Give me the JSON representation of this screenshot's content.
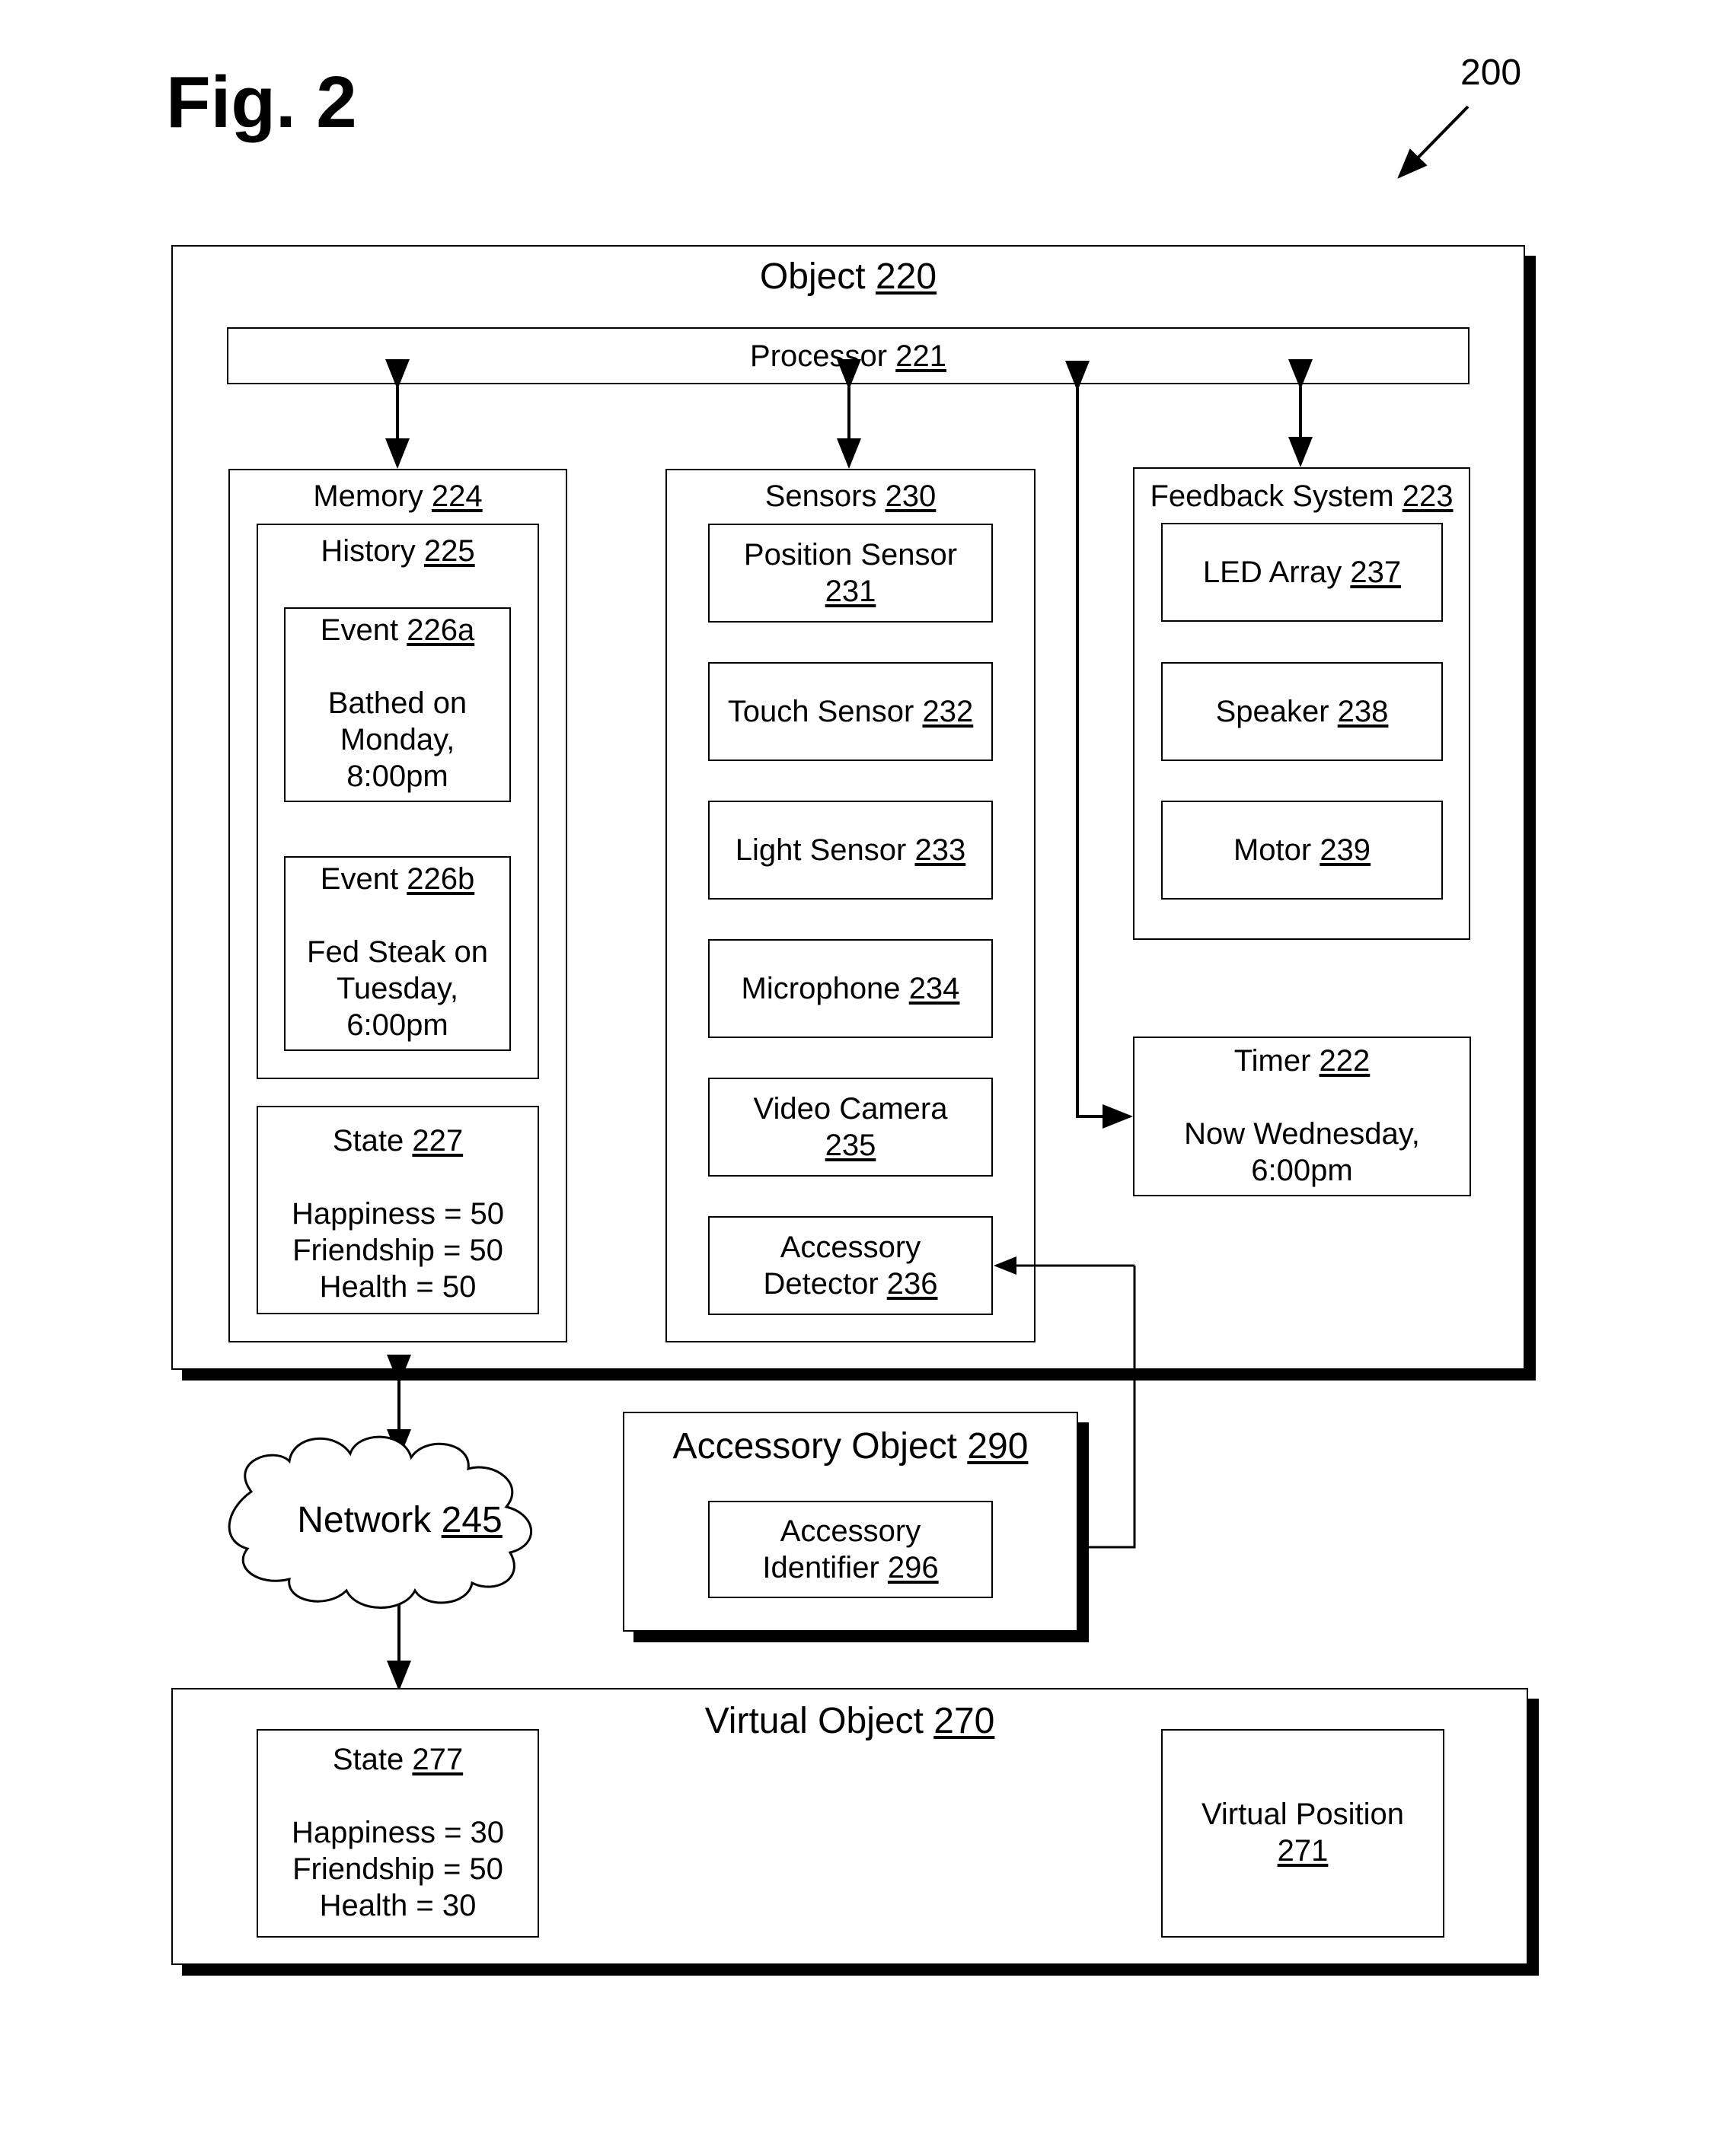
{
  "figure": {
    "title": "Fig. 2",
    "reference": "200"
  },
  "object": {
    "name": "Object",
    "num": "220",
    "processor": {
      "name": "Processor",
      "num": "221"
    },
    "memory": {
      "name": "Memory",
      "num": "224",
      "history": {
        "name": "History",
        "num": "225",
        "events": [
          {
            "name": "Event",
            "num": "226a",
            "lines": [
              "Bathed on",
              "Monday,",
              "8:00pm"
            ]
          },
          {
            "name": "Event",
            "num": "226b",
            "lines": [
              "Fed Steak on",
              "Tuesday,",
              "6:00pm"
            ]
          }
        ]
      },
      "state": {
        "name": "State",
        "num": "227",
        "lines": [
          "Happiness = 50",
          "Friendship = 50",
          "Health = 50"
        ]
      }
    },
    "sensors": {
      "name": "Sensors",
      "num": "230",
      "items": [
        {
          "name": "Position Sensor",
          "num": "231"
        },
        {
          "name": "Touch Sensor",
          "num": "232"
        },
        {
          "name": "Light Sensor",
          "num": "233"
        },
        {
          "name": "Microphone",
          "num": "234"
        },
        {
          "name": "Video Camera",
          "num": "235"
        },
        {
          "name": "Accessory Detector",
          "num": "236"
        }
      ]
    },
    "feedback": {
      "name": "Feedback System",
      "num": "223",
      "items": [
        {
          "name": "LED Array",
          "num": "237"
        },
        {
          "name": "Speaker",
          "num": "238"
        },
        {
          "name": "Motor",
          "num": "239"
        }
      ]
    },
    "timer": {
      "name": "Timer",
      "num": "222",
      "lines": [
        "Now Wednesday,",
        "6:00pm"
      ]
    }
  },
  "network": {
    "name": "Network",
    "num": "245"
  },
  "accessory_object": {
    "name": "Accessory Object",
    "num": "290",
    "identifier": {
      "line1": "Accessory",
      "line2": "Identifier",
      "num": "296"
    }
  },
  "virtual_object": {
    "name": "Virtual Object",
    "num": "270",
    "state": {
      "name": "State",
      "num": "277",
      "lines": [
        "Happiness = 30",
        "Friendship = 50",
        "Health = 30"
      ]
    },
    "position": {
      "line1": "Virtual Position",
      "num": "271"
    }
  }
}
